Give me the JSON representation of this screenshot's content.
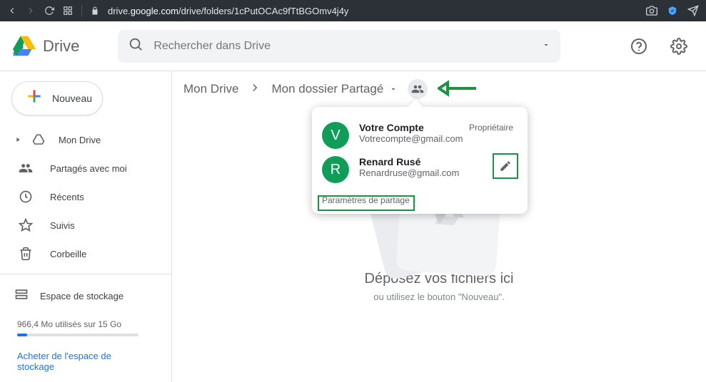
{
  "browser": {
    "url_prefix": "drive.",
    "url_domain": "google.com",
    "url_path": "/drive/folders/1cPutOCAc9fTtBGOmv4j4y"
  },
  "app": {
    "title": "Drive"
  },
  "search": {
    "placeholder": "Rechercher dans Drive"
  },
  "sidebar": {
    "new_label": "Nouveau",
    "items": [
      {
        "label": "Mon Drive"
      },
      {
        "label": "Partagés avec moi"
      },
      {
        "label": "Récents"
      },
      {
        "label": "Suivis"
      },
      {
        "label": "Corbeille"
      }
    ]
  },
  "storage": {
    "title": "Espace de stockage",
    "used_text": "966,4 Mo utilisés sur 15 Go",
    "buy_link": "Acheter de l'espace de stockage"
  },
  "breadcrumb": {
    "root": "Mon Drive",
    "current": "Mon dossier Partagé"
  },
  "share_popover": {
    "people": [
      {
        "initial": "V",
        "name": "Votre Compte",
        "email": "Votrecompte@gmail.com",
        "role": "Propriétaire"
      },
      {
        "initial": "R",
        "name": "Renard Rusé",
        "email": "Renardruse@gmail.com",
        "role": ""
      }
    ],
    "settings_link": "Paramètres de partage"
  },
  "dropzone": {
    "title": "Déposez vos fichiers ici",
    "subtitle": "ou utilisez le bouton \"Nouveau\"."
  },
  "colors": {
    "accent": "#1a73e8",
    "annotation": "#1c9342"
  }
}
